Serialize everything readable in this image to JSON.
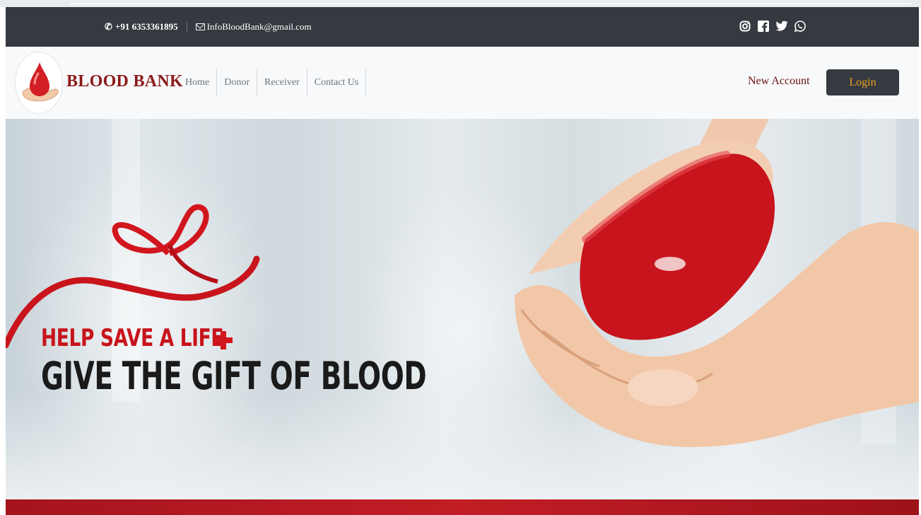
{
  "topbar": {
    "phone": "+91 6353361895",
    "email": "InfoBloodBank@gmail.com",
    "social_icons": [
      "instagram-icon",
      "facebook-icon",
      "twitter-icon",
      "whatsapp-icon"
    ]
  },
  "navbar": {
    "brand": "BLOOD BANK",
    "links": [
      "Home",
      "Donor",
      "Receiver",
      "Contact Us"
    ],
    "new_account": "New Account",
    "login": "Login"
  },
  "hero": {
    "line1": "HELP SAVE A LIFE",
    "line2": "GIVE THE GIFT OF BLOOD"
  },
  "colors": {
    "topbar_bg": "#343a40",
    "brand": "#8b1a1a",
    "login_text": "#f0a020",
    "accent_red": "#c8141c"
  }
}
